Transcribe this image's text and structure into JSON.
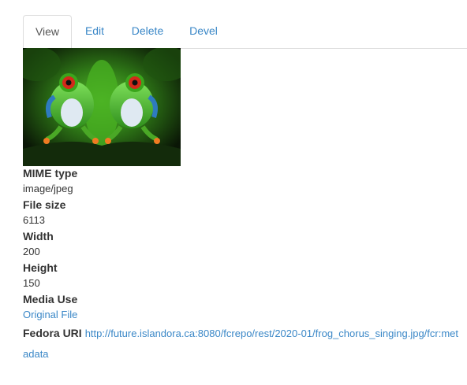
{
  "tabs": [
    {
      "label": "View",
      "active": true
    },
    {
      "label": "Edit",
      "active": false
    },
    {
      "label": "Delete",
      "active": false
    },
    {
      "label": "Devel",
      "active": false
    }
  ],
  "image": {
    "description_icon": "frog-image"
  },
  "fields": {
    "mime_type": {
      "label": "MIME type",
      "value": "image/jpeg"
    },
    "file_size": {
      "label": "File size",
      "value": "6113"
    },
    "width": {
      "label": "Width",
      "value": "200"
    },
    "height": {
      "label": "Height",
      "value": "150"
    },
    "media_use": {
      "label": "Media Use",
      "value": "Original File"
    },
    "fedora_uri": {
      "label": "Fedora URI",
      "value": "http://future.islandora.ca:8080/fcrepo/rest/2020-01/frog_chorus_singing.jpg/fcr:metadata"
    }
  },
  "colors": {
    "link": "#3a87c7",
    "text": "#333333",
    "border": "#dddddd"
  }
}
